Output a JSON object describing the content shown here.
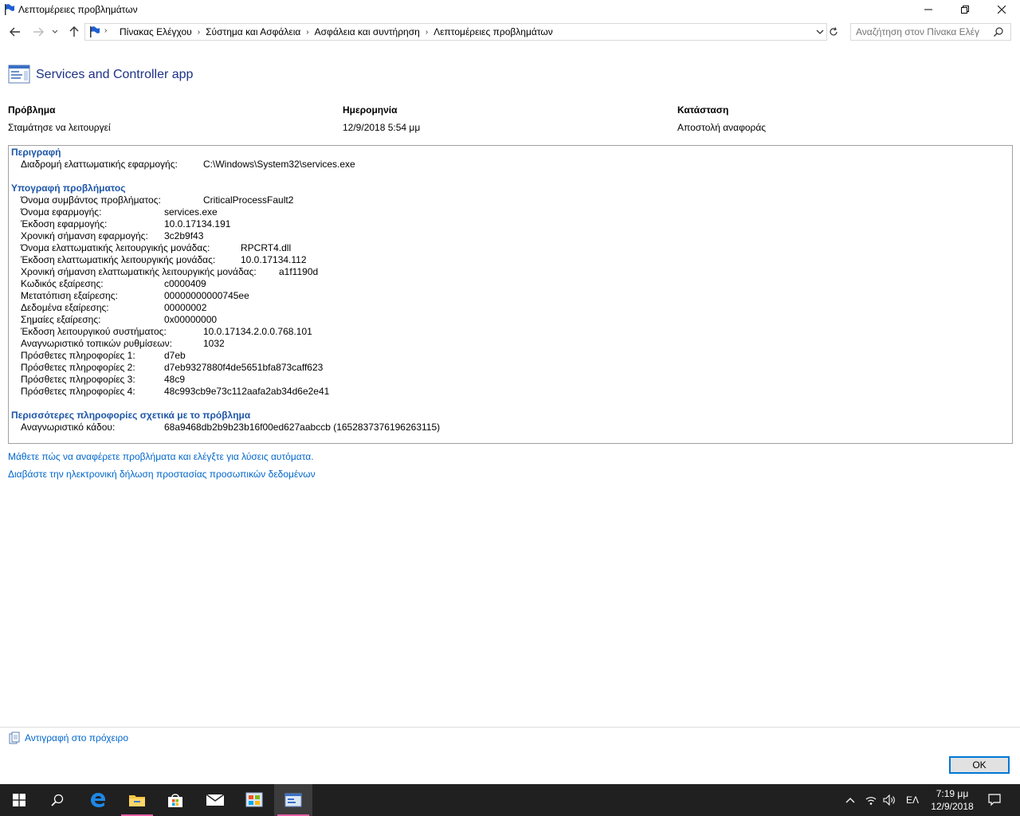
{
  "window": {
    "title": "Λεπτομέρειες προβλημάτων"
  },
  "breadcrumbs": [
    "Πίνακας Ελέγχου",
    "Σύστημα και Ασφάλεια",
    "Ασφάλεια και συντήρηση",
    "Λεπτομέρειες προβλημάτων"
  ],
  "search": {
    "placeholder": "Αναζήτηση στον Πίνακα Ελέγ"
  },
  "app_name": "Services and Controller app",
  "summary": {
    "problem_label": "Πρόβλημα",
    "problem_value": "Σταμάτησε να λειτουργεί",
    "date_label": "Ημερομηνία",
    "date_value": "12/9/2018 5:54 μμ",
    "status_label": "Κατάσταση",
    "status_value": "Αποστολή αναφοράς"
  },
  "description": {
    "heading": "Περιγραφή",
    "label": "Διαδρομή ελαττωματικής εφαρμογής:",
    "value": "C:\\Windows\\System32\\services.exe"
  },
  "signature": {
    "heading": "Υπογραφή προβλήματος",
    "rows": [
      {
        "label": "Όνομα συμβάντος προβλήματος:",
        "value": "CriticalProcessFault2"
      },
      {
        "label": "Όνομα εφαρμογής:",
        "value": "services.exe"
      },
      {
        "label": "Έκδοση εφαρμογής:",
        "value": "10.0.17134.191"
      },
      {
        "label": "Χρονική σήμανση εφαρμογής:",
        "value": "3c2b9f43"
      },
      {
        "label": "Όνομα ελαττωματικής λειτουργικής μονάδας:",
        "value": "RPCRT4.dll"
      },
      {
        "label": "Έκδοση ελαττωματικής λειτουργικής μονάδας:",
        "value": "10.0.17134.112"
      },
      {
        "label": "Χρονική σήμανση ελαττωματικής λειτουργικής μονάδας:",
        "value": "a1f1190d"
      },
      {
        "label": "Κωδικός εξαίρεσης:",
        "value": "c0000409"
      },
      {
        "label": "Μετατόπιση εξαίρεσης:",
        "value": "00000000000745ee"
      },
      {
        "label": "Δεδομένα εξαίρεσης:",
        "value": "00000002"
      },
      {
        "label": "Σημαίες εξαίρεσης:",
        "value": "0x00000000"
      },
      {
        "label": "Έκδοση λειτουργικού συστήματος:",
        "value": "10.0.17134.2.0.0.768.101"
      },
      {
        "label": "Αναγνωριστικό τοπικών ρυθμίσεων:",
        "value": "1032"
      },
      {
        "label": "Πρόσθετες πληροφορίες 1:",
        "value": "d7eb"
      },
      {
        "label": "Πρόσθετες πληροφορίες 2:",
        "value": "d7eb9327880f4de5651bfa873caff623"
      },
      {
        "label": "Πρόσθετες πληροφορίες 3:",
        "value": "48c9"
      },
      {
        "label": "Πρόσθετες πληροφορίες 4:",
        "value": "48c993cb9e73c112aafa2ab34d6e2e41"
      }
    ]
  },
  "more_info": {
    "heading": "Περισσότερες πληροφορίες σχετικά με το πρόβλημα",
    "label": "Αναγνωριστικό κάδου:",
    "value": "68a9468db2b9b23b16f00ed627aabccb (1652837376196263115)"
  },
  "links": {
    "report_link": "Μάθετε πώς να αναφέρετε προβλήματα και ελέγξτε για λύσεις αυτόματα.",
    "privacy_link": "Διαβάστε την ηλεκτρονική δήλωση προστασίας προσωπικών δεδομένων",
    "copy_link": "Αντιγραφή στο πρόχειρο"
  },
  "ok_label": "OK",
  "taskbar": {
    "language": "ΕΛ",
    "time": "7:19 μμ",
    "date": "12/9/2018"
  },
  "colors": {
    "link": "#0066cc",
    "section_heading": "#1e56a8",
    "taskbar": "#202020",
    "accent": "#0078d7"
  }
}
